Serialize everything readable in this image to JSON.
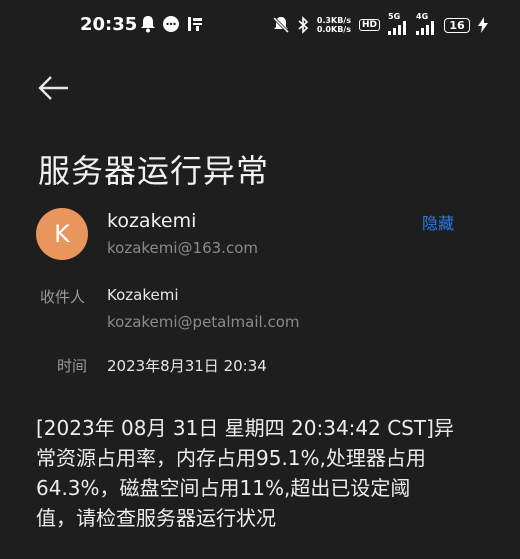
{
  "status_bar": {
    "time": "20:35",
    "left_icons": [
      "bell-icon",
      "chat-bubble-icon",
      "taobao-icon"
    ],
    "net_speed_up": "0.3KB/s",
    "net_speed_down": "0.0KB/s",
    "hd_label": "HD",
    "network_5g": "5G",
    "network_4g": "4G",
    "battery": "16"
  },
  "email": {
    "subject": "服务器运行异常",
    "sender": {
      "initial": "K",
      "name": "kozakemi",
      "email": "kozakemi@163.com",
      "avatar_color": "#e8955e"
    },
    "hide_label": "隐藏",
    "recipient_label": "收件人",
    "recipient_name": "Kozakemi",
    "recipient_email": "kozakemi@petalmail.com",
    "time_label": "时间",
    "time_value": "2023年8月31日 20:34",
    "body_lines": [
      "[2023年 08月 31日 星期四 20:34:42 CST]异",
      "常资源占用率，内存占用95.1%,处理器占用",
      "64.3%，磁盘空间占用11%,超出已设定阈",
      "值，请检查服务器运行状况"
    ]
  },
  "colors": {
    "background": "#1e1e1e",
    "accent": "#2c7ae6"
  }
}
